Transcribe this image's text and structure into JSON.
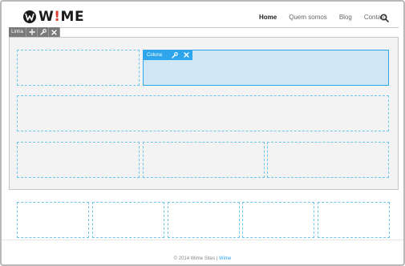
{
  "brand": {
    "name_prefix": "W",
    "name_bang": "!",
    "name_suffix": "ME"
  },
  "nav": {
    "items": [
      {
        "label": "Home",
        "active": true
      },
      {
        "label": "Quem somos",
        "active": false
      },
      {
        "label": "Blog",
        "active": false
      },
      {
        "label": "Contato",
        "active": false
      }
    ],
    "search_icon": "search-icon"
  },
  "row_toolbar": {
    "label": "Linha",
    "icons": [
      "move-icon",
      "wrench-icon",
      "close-icon"
    ]
  },
  "column_toolbar": {
    "label": "Coluna",
    "icons": [
      "wrench-icon",
      "close-icon"
    ]
  },
  "footer": {
    "text": "© 2014 Wime Sites | ",
    "link": "Wime"
  },
  "colors": {
    "accent": "#2fa6ec",
    "cell_border": "#6cc6ee",
    "selected_fill": "#cfe6f5",
    "toolbar_gray": "#7a7a7a",
    "logo_bang": "#e23b2e"
  }
}
